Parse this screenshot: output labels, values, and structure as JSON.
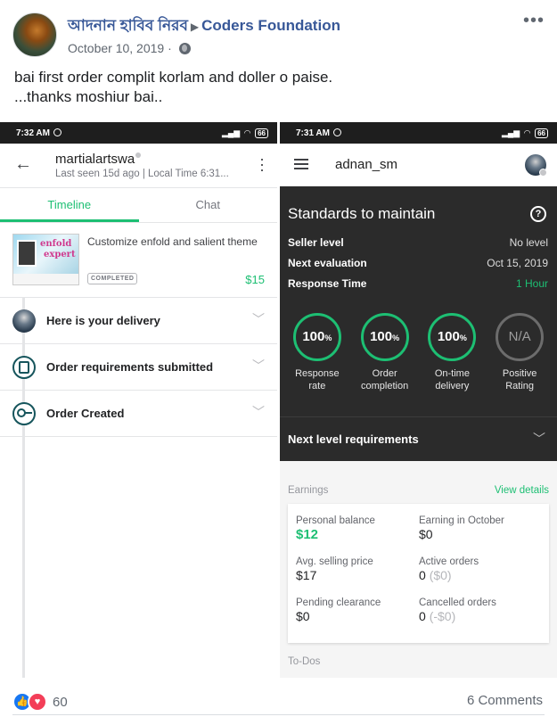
{
  "post": {
    "author": "আদনান হাবিব নিরব",
    "group": "Coders Foundation",
    "date": "October 10, 2019",
    "text_line1": "bai first order complit korlam and doller o paise.",
    "text_line2": "...thanks moshiur bai..",
    "reactions_count": "60",
    "comments_label": "6 Comments"
  },
  "left_phone": {
    "time": "7:32 AM",
    "battery": "66",
    "contact_name": "martialartswa",
    "contact_status": "Last seen 15d ago | Local Time 6:31...",
    "tabs": [
      "Timeline",
      "Chat"
    ],
    "order": {
      "thumb_text1": "enfold",
      "thumb_text2": "expert",
      "title": "Customize enfold and salient theme",
      "badge": "COMPLETED",
      "price": "$15"
    },
    "timeline": [
      {
        "label": "Here is your delivery"
      },
      {
        "label": "Order requirements submitted"
      },
      {
        "label": "Order Created"
      }
    ]
  },
  "right_phone": {
    "time": "7:31 AM",
    "battery": "66",
    "username": "adnan_sm",
    "standards_title": "Standards to maintain",
    "stats": [
      {
        "key": "Seller level",
        "value": "No level"
      },
      {
        "key": "Next evaluation",
        "value": "Oct 15, 2019"
      },
      {
        "key": "Response Time",
        "value": "1 Hour"
      }
    ],
    "circles": [
      {
        "value": "100",
        "unit": "%",
        "caption1": "Response",
        "caption2": "rate"
      },
      {
        "value": "100",
        "unit": "%",
        "caption1": "Order",
        "caption2": "completion"
      },
      {
        "value": "100",
        "unit": "%",
        "caption1": "On-time",
        "caption2": "delivery"
      },
      {
        "value": "N/A",
        "unit": "",
        "caption1": "Positive",
        "caption2": "Rating"
      }
    ],
    "next_level": "Next level requirements",
    "earnings_label": "Earnings",
    "view_details": "View details",
    "earnings": {
      "personal_balance_label": "Personal balance",
      "personal_balance": "$12",
      "earning_month_label": "Earning in October",
      "earning_month": "$0",
      "avg_price_label": "Avg. selling price",
      "avg_price": "$17",
      "active_orders_label": "Active orders",
      "active_orders": "0",
      "active_orders_amount": "($0)",
      "pending_label": "Pending clearance",
      "pending": "$0",
      "cancelled_label": "Cancelled orders",
      "cancelled": "0",
      "cancelled_amount": "(-$0)"
    },
    "todos_label": "To-Dos"
  },
  "colors": {
    "fiverr_green": "#1dbf73",
    "facebook_link": "#385898",
    "dark_panel": "#2b2b2b"
  }
}
